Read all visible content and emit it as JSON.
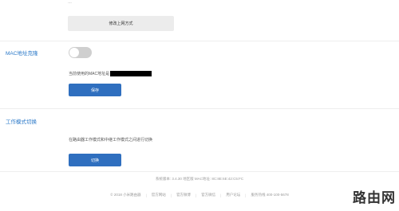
{
  "top_partial_text": "…",
  "connection": {
    "change_button_label": "修改上网方式"
  },
  "mac_clone": {
    "title": "MAC地址克隆",
    "current_mac_label": "当前使用的MAC地址是",
    "save_label": "保存"
  },
  "work_mode": {
    "title": "工作模式切换",
    "description": "在路由器工作模式和中继工作模式之间进行切换",
    "switch_label": "切换"
  },
  "footer": {
    "version_line": "系统版本: 3.4.30  地区版  MAC地址: 8C:8E:6E:42:C5:FC",
    "copyright": "© 2018 小米路由器",
    "links": [
      "官方网站",
      "官方微博",
      "官方微信",
      "用户论坛",
      "服务热线 400-100-5678"
    ]
  },
  "watermark": "路由网",
  "colors": {
    "accent": "#2f6fbf",
    "title": "#2a78c8",
    "toggle_off": "#cfcfcf"
  }
}
